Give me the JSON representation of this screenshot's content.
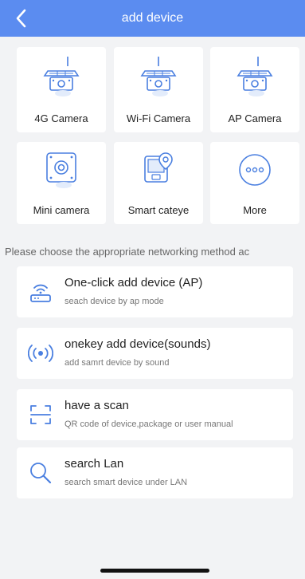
{
  "header": {
    "title": "add device",
    "back_icon": "chevron-left-icon"
  },
  "devices": [
    {
      "label": "4G Camera",
      "icon": "solar-camera-icon"
    },
    {
      "label": "Wi-Fi Camera",
      "icon": "solar-camera-icon"
    },
    {
      "label": "AP Camera",
      "icon": "solar-camera-icon"
    },
    {
      "label": "Mini camera",
      "icon": "mini-camera-icon"
    },
    {
      "label": "Smart cateye",
      "icon": "cateye-icon"
    },
    {
      "label": "More",
      "icon": "more-icon"
    }
  ],
  "info_text": "Please choose the appropriate networking method ac",
  "options": [
    {
      "title": "One-click add device (AP)",
      "subtitle": "seach device by ap mode",
      "icon": "router-wifi-icon"
    },
    {
      "title": "onekey add device(sounds)",
      "subtitle": "add samrt device by sound",
      "icon": "sound-wave-icon"
    },
    {
      "title": "have a scan",
      "subtitle": "QR code of device,package or user manual",
      "icon": "scan-icon"
    },
    {
      "title": "search Lan",
      "subtitle": "search smart device under LAN",
      "icon": "search-icon"
    }
  ],
  "colors": {
    "header": "#5b8cf0",
    "icon_blue": "#4a7fe0",
    "background": "#f2f3f5"
  }
}
